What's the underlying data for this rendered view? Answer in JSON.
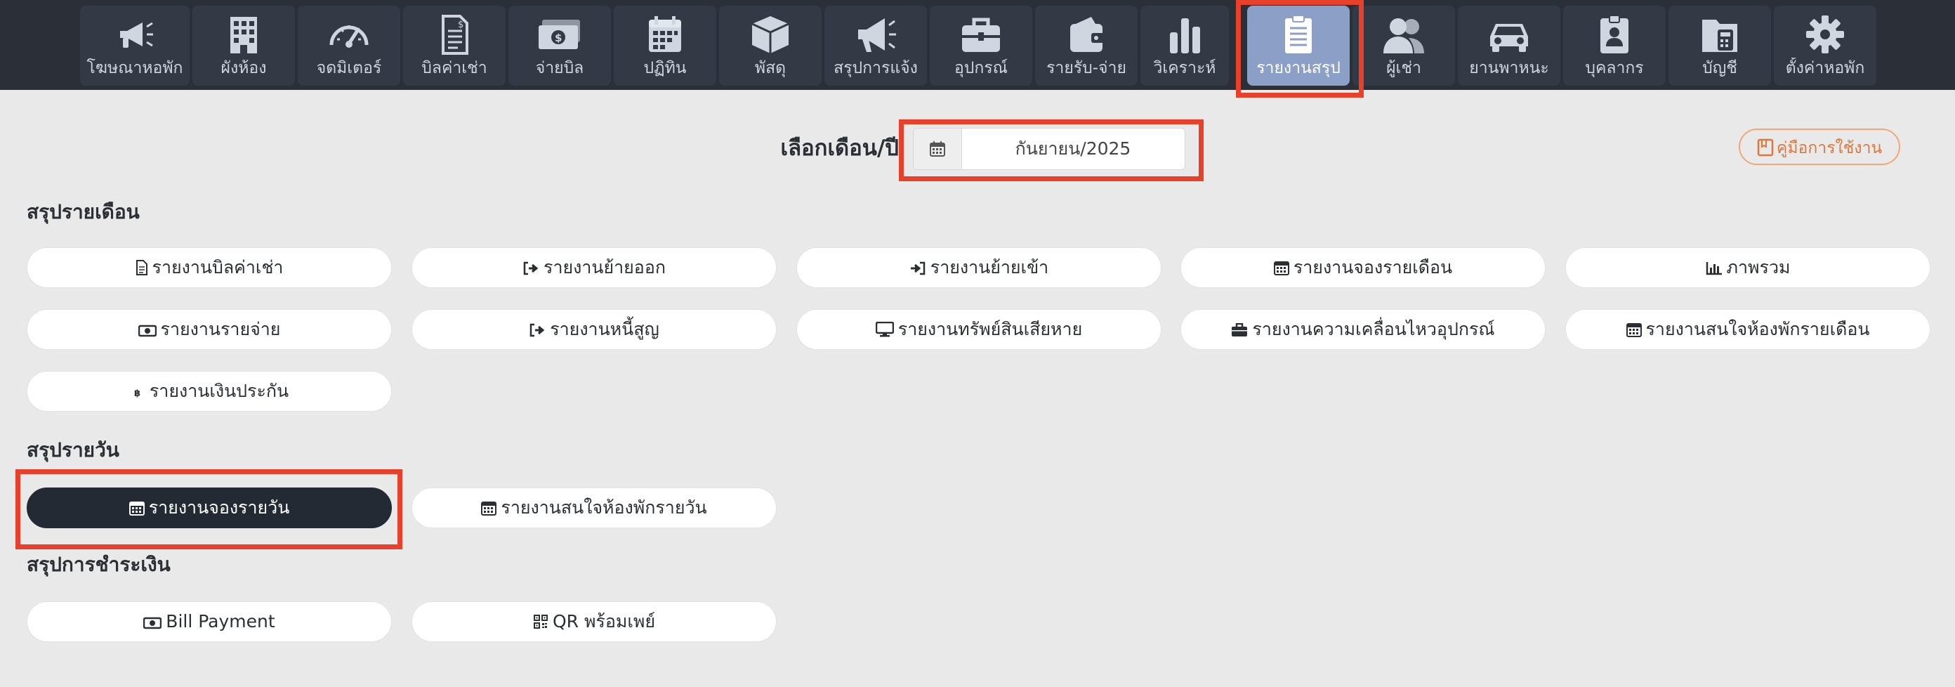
{
  "nav": {
    "items": [
      {
        "label": "โฆษณาหอพัก",
        "icon": "megaphone-icon"
      },
      {
        "label": "ผังห้อง",
        "icon": "building-icon"
      },
      {
        "label": "จดมิเตอร์",
        "icon": "gauge-icon"
      },
      {
        "label": "บิลค่าเช่า",
        "icon": "invoice-icon"
      },
      {
        "label": "จ่ายบิล",
        "icon": "money-icon"
      },
      {
        "label": "ปฏิทิน",
        "icon": "calendar-icon"
      },
      {
        "label": "พัสดุ",
        "icon": "box-icon"
      },
      {
        "label": "สรุปการแจ้ง",
        "icon": "bullhorn-icon"
      },
      {
        "label": "อุปกรณ์",
        "icon": "toolbox-icon"
      },
      {
        "label": "รายรับ-จ่าย",
        "icon": "wallet-icon"
      },
      {
        "label": "วิเคราะห์",
        "icon": "bar-chart-icon"
      },
      {
        "label": "รายงานสรุป",
        "icon": "report-icon",
        "active": true
      },
      {
        "label": "ผู้เช่า",
        "icon": "users-icon"
      },
      {
        "label": "ยานพาหนะ",
        "icon": "car-icon"
      },
      {
        "label": "บุคลากร",
        "icon": "staff-icon"
      },
      {
        "label": "บัญชี",
        "icon": "accounting-icon"
      },
      {
        "label": "ตั้งค่าหอพัก",
        "icon": "gear-icon"
      }
    ]
  },
  "picker": {
    "label": "เลือกเดือน/ปี",
    "value": "กันยายน/2025"
  },
  "manual_button": "คู่มือการใช้งาน",
  "sections": {
    "monthly": {
      "title": "สรุปรายเดือน",
      "buttons": [
        "รายงานบิลค่าเช่า",
        "รายงานย้ายออก",
        "รายงานย้ายเข้า",
        "รายงานจองรายเดือน",
        "ภาพรวม",
        "รายงานรายจ่าย",
        "รายงานหนี้สูญ",
        "รายงานทรัพย์สินเสียหาย",
        "รายงานความเคลื่อนไหวอุปกรณ์",
        "รายงานสนใจห้องพักรายเดือน",
        "รายงานเงินประกัน"
      ]
    },
    "daily": {
      "title": "สรุปรายวัน",
      "buttons": [
        "รายงานจองรายวัน",
        "รายงานสนใจห้องพักรายวัน"
      ]
    },
    "payment": {
      "title": "สรุปการชำระเงิน",
      "buttons": [
        "Bill Payment",
        "QR พร้อมเพย์"
      ]
    }
  },
  "colors": {
    "nav_bg": "#2a2f38",
    "nav_item": "#333a45",
    "nav_active": "#8c9fc6",
    "highlight": "#e8412b",
    "page_bg": "#e9e9e9",
    "accent_orange": "#e0773a",
    "dark_button": "#242a33"
  }
}
